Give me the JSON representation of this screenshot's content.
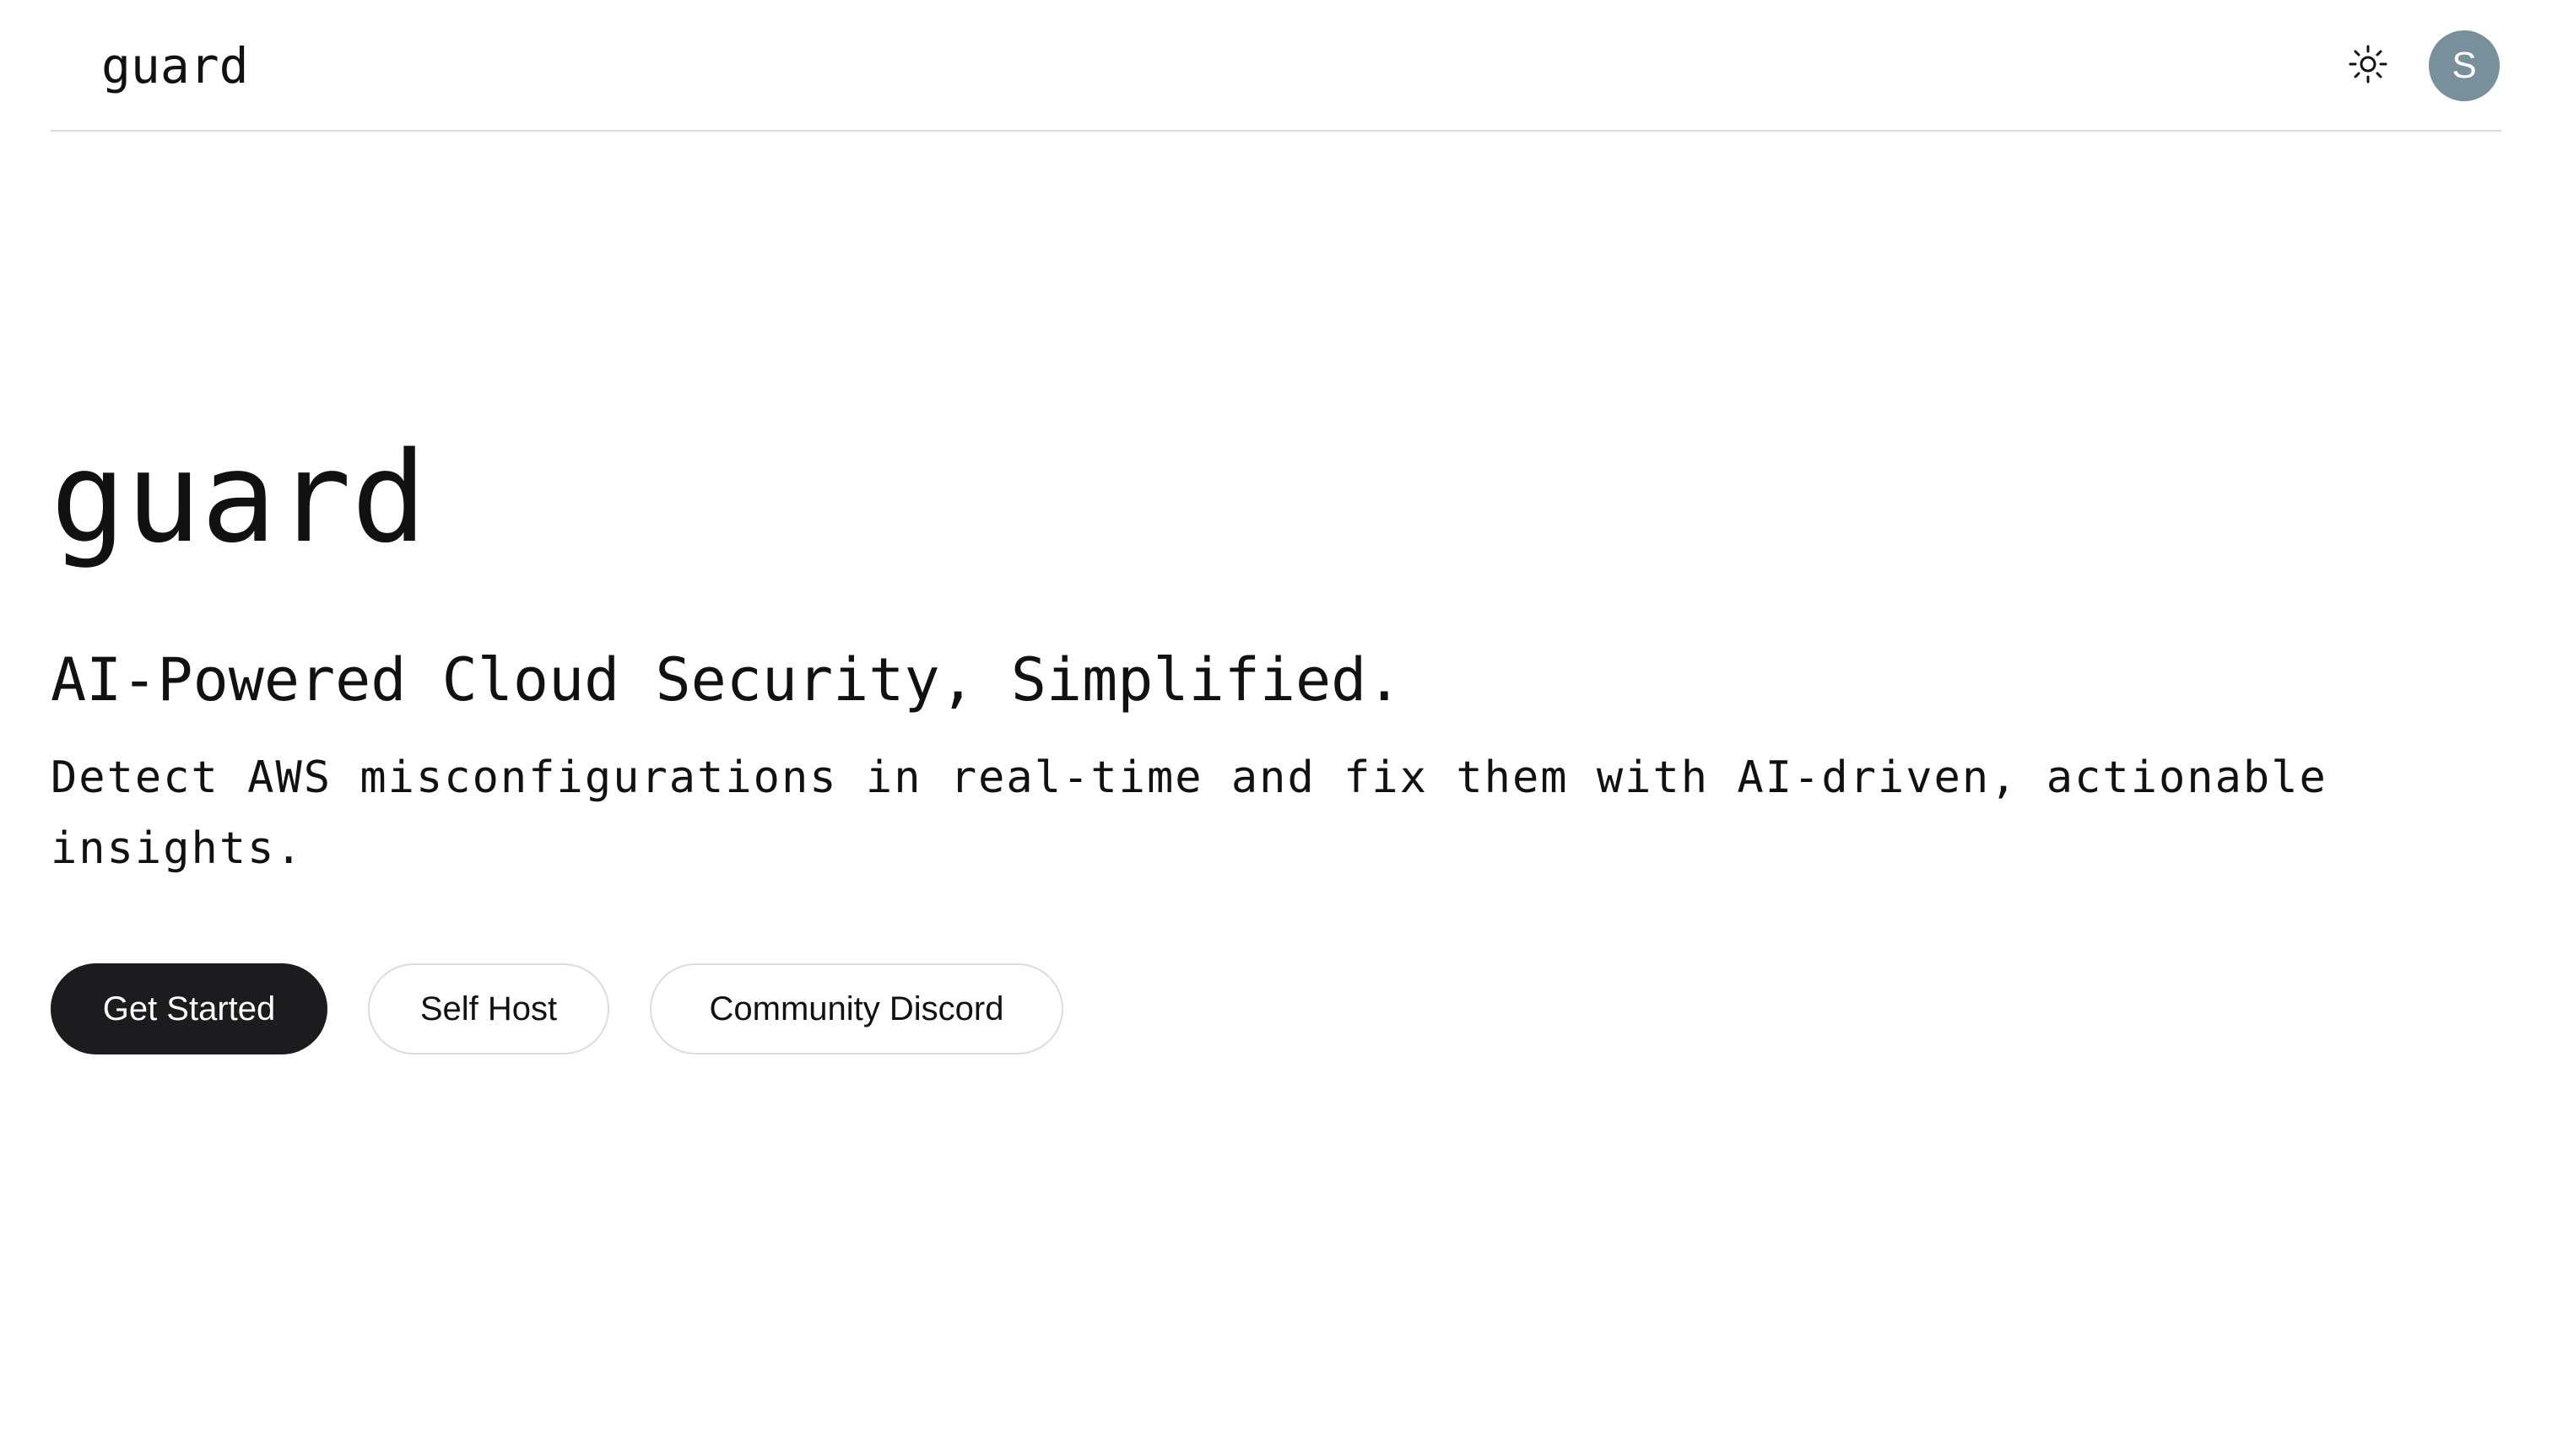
{
  "header": {
    "brand": "guard",
    "theme_toggle_icon": "sun-icon",
    "avatar_initial": "S",
    "avatar_color": "#78909c"
  },
  "hero": {
    "title": "guard",
    "subtitle": "AI-Powered Cloud Security, Simplified.",
    "description": "Detect AWS misconfigurations in real-time and fix them with AI-driven, actionable insights."
  },
  "actions": {
    "get_started": "Get Started",
    "self_host": "Self Host",
    "community_discord": "Community Discord"
  },
  "colors": {
    "primary_button_bg": "#1c1c1e",
    "text": "#111111",
    "border": "#dcdcdc"
  }
}
